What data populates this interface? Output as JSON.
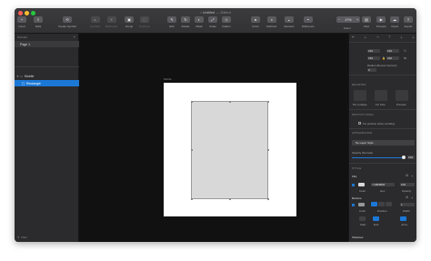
{
  "window": {
    "title": "Untitled",
    "title_suffix": "— Edited"
  },
  "colors": {
    "accent": "#1c78d6",
    "traffic_close": "#fe5f57",
    "traffic_min": "#febc2e",
    "traffic_max": "#28c840"
  },
  "toolbar": {
    "insert": "Insert",
    "data": "Data",
    "create_symbol": "Create Symbol",
    "forward": "Forward",
    "backward": "Backward",
    "group": "Group",
    "ungroup": "Ungroup",
    "edit": "Edit",
    "rotate": "Rotate",
    "mask": "Mask",
    "scale": "Scale",
    "flatten": "Flatten",
    "union": "Union",
    "subtract": "Subtract",
    "intersect": "Intersect",
    "difference": "Difference",
    "zoom_value": "47%",
    "zoom_label": "Zoom",
    "view": "View",
    "preview": "Preview",
    "cloud": "Cloud",
    "export": "Export"
  },
  "layers_panel": {
    "pages_header": "PAGES",
    "pages": [
      "Page 1"
    ],
    "layers": [
      {
        "name": "Mobile",
        "selected": false
      },
      {
        "name": "Rectangle",
        "selected": true
      }
    ],
    "filter_label": "Filter"
  },
  "canvas": {
    "artboard_label": "Mobile"
  },
  "inspector": {
    "x": "216",
    "y": "120",
    "w": "150",
    "h": "190",
    "radius_label": "Radius (Round Corners)",
    "radius_value": "0",
    "resizing_header": "RESIZING",
    "resizing_options": [
      "Pin to Edge",
      "Fix Size",
      "Preview"
    ],
    "prototyping_header": "PROTOTYPING",
    "fix_position_label": "Fix position when scrolling",
    "appearance_header": "APPEARANCE",
    "layer_style": "No Layer Style",
    "opacity_label": "Opacity (Normal)",
    "opacity_value": "100",
    "style_header": "STYLE",
    "fills_header": "Fills",
    "fill_hex": "D8D8D8",
    "fill_opacity": "100",
    "fill_sublabels": [
      "Color",
      "Hex",
      "Opacity"
    ],
    "borders_header": "Borders",
    "border_sublabels": [
      "Color",
      "Position",
      "Width"
    ],
    "border_position": "Inside",
    "border_width": "1",
    "end_labels": [
      "Start",
      "End",
      "Joins"
    ],
    "shadows_header": "Shadows"
  }
}
